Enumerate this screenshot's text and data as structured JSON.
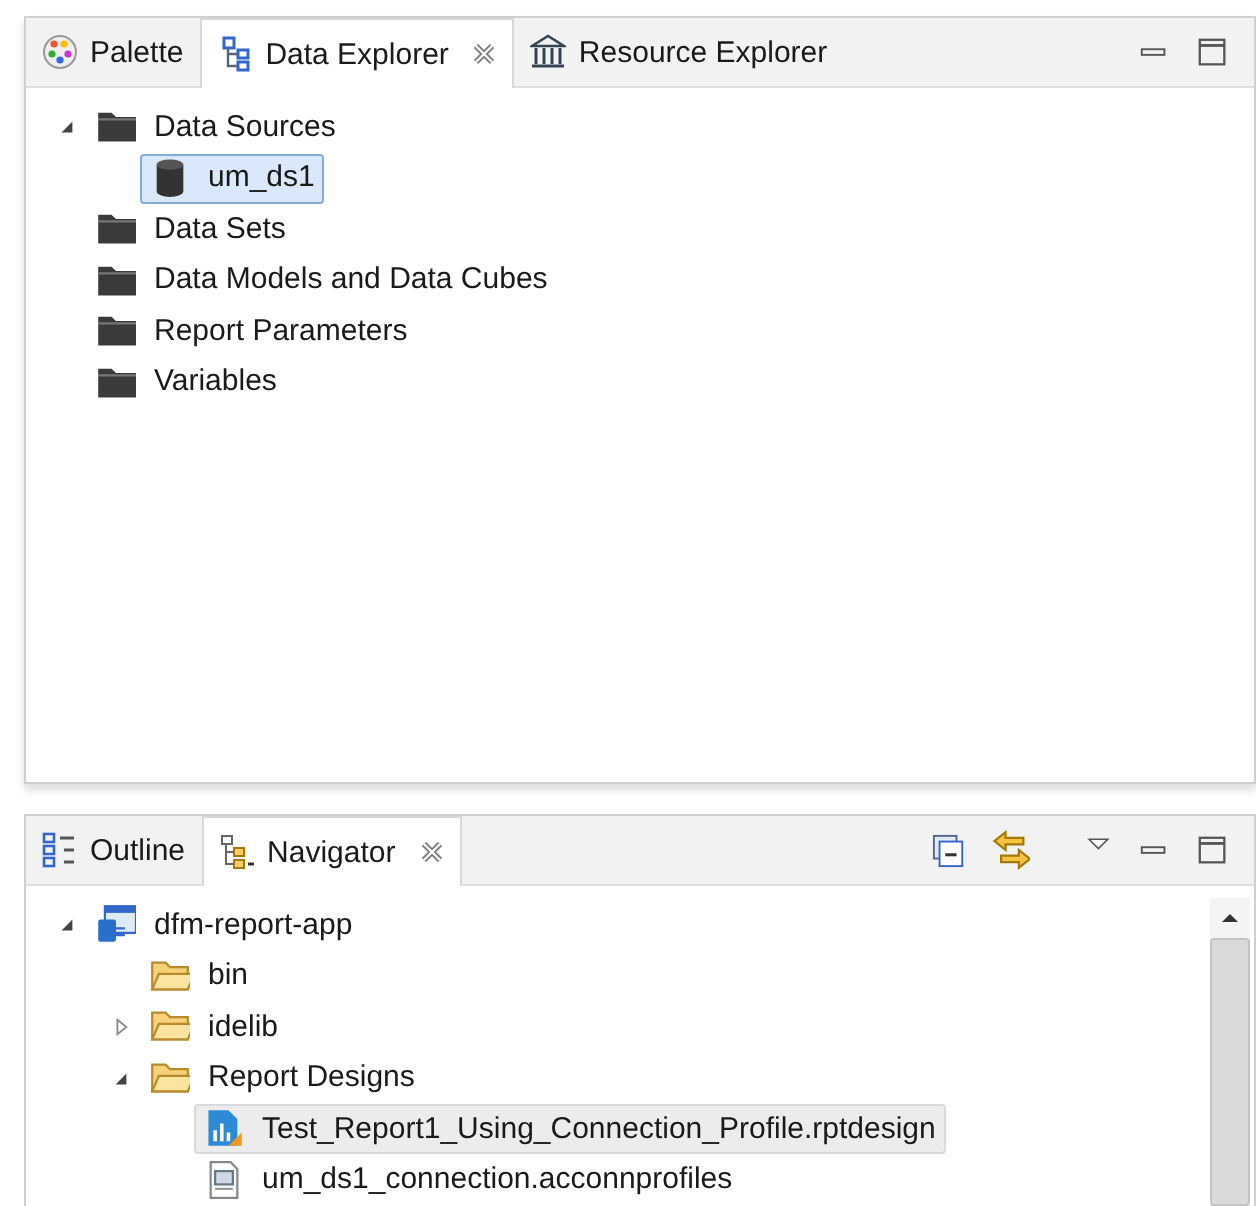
{
  "panels": [
    {
      "active": true,
      "tabs": [
        {
          "label": "Palette",
          "kind": "palette",
          "selected": false,
          "closable": false
        },
        {
          "label": "Data Explorer",
          "kind": "data-explorer",
          "selected": true,
          "closable": true
        },
        {
          "label": "Resource Explorer",
          "kind": "resource-explorer",
          "selected": false,
          "closable": false
        }
      ],
      "toolbar": [
        {
          "kind": "minimize"
        },
        {
          "kind": "maximize"
        }
      ],
      "scrollbar": false,
      "tree": [
        {
          "label": "Data Sources",
          "kind": "folder",
          "expanded": true,
          "selected": false,
          "children": [
            {
              "label": "um_ds1",
              "kind": "database",
              "selected": true
            }
          ]
        },
        {
          "label": "Data Sets",
          "kind": "folder",
          "selected": false
        },
        {
          "label": "Data Models and Data Cubes",
          "kind": "folder",
          "selected": false
        },
        {
          "label": "Report Parameters",
          "kind": "folder",
          "selected": false
        },
        {
          "label": "Variables",
          "kind": "folder",
          "selected": false
        }
      ]
    },
    {
      "active": false,
      "tabs": [
        {
          "label": "Outline",
          "kind": "outline",
          "selected": false,
          "closable": false
        },
        {
          "label": "Navigator",
          "kind": "navigator",
          "selected": true,
          "closable": true
        }
      ],
      "toolbar": [
        {
          "kind": "collapse-all"
        },
        {
          "kind": "link"
        },
        {
          "kind": "view-menu"
        },
        {
          "kind": "minimize"
        },
        {
          "kind": "maximize"
        }
      ],
      "scrollbar": true,
      "tree": [
        {
          "label": "dfm-report-app",
          "kind": "project",
          "expanded": true,
          "selected": false,
          "children": [
            {
              "label": "bin",
              "kind": "folder-open",
              "selected": false
            },
            {
              "label": "idelib",
              "kind": "folder-open",
              "expanded": false,
              "selected": false
            },
            {
              "label": "Report Designs",
              "kind": "folder-open",
              "expanded": true,
              "selected": false,
              "children": [
                {
                  "label": "Test_Report1_Using_Connection_Profile.rptdesign",
                  "kind": "report",
                  "selected": true
                },
                {
                  "label": "um_ds1_connection.acconnprofiles",
                  "kind": "file",
                  "selected": false
                }
              ]
            }
          ]
        }
      ]
    }
  ]
}
